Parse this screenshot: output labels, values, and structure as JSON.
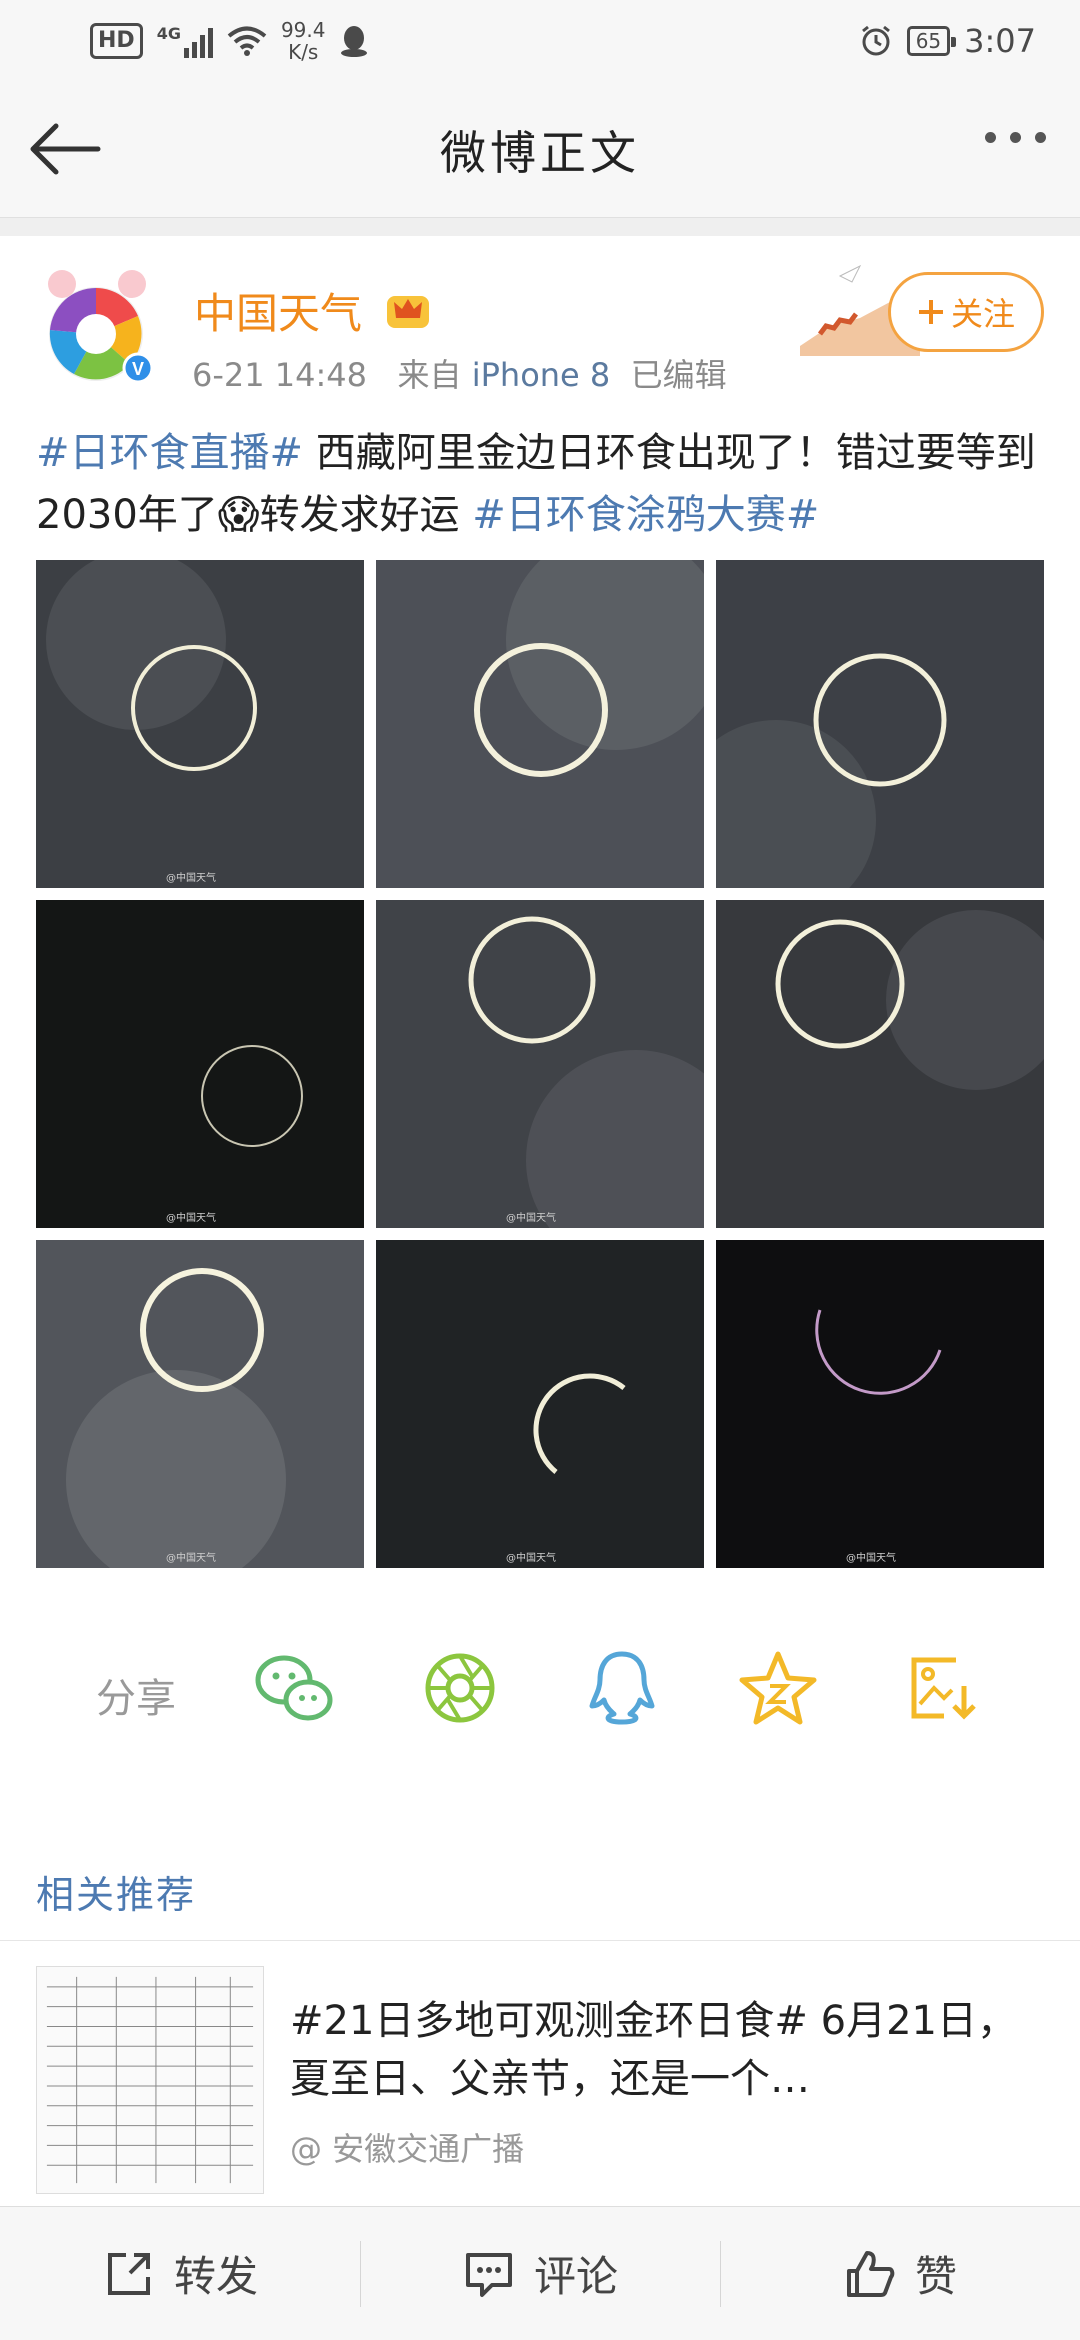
{
  "status_bar": {
    "hd": "HD",
    "network": "4G",
    "speed_value": "99.4",
    "speed_unit": "K/s",
    "battery": "65",
    "time": "3:07"
  },
  "nav": {
    "title": "微博正文"
  },
  "post": {
    "author": "中国天气",
    "time": "6-21 14:48",
    "source_prefix": "来自",
    "source": "iPhone 8",
    "edited": "已编辑",
    "follow_label": "关注",
    "text_parts": {
      "tag1": "#日环食直播#",
      "body1": " 西藏阿里金边日环食出现了！错过要等到2030年了",
      "body2": "转发求好运 ",
      "tag2": "#日环食涂鸦大赛#"
    },
    "image_watermark": "@中国天气"
  },
  "share": {
    "label": "分享"
  },
  "related": {
    "title": "相关推荐",
    "text": "#21日多地可观测金环日食# 6月21日，夏至日、父亲节，还是一个…",
    "source": "@ 安徽交通广播"
  },
  "bottom_bar": {
    "repost": "转发",
    "comment": "评论",
    "like": "赞"
  },
  "colors": {
    "accent_orange": "#f08a1b",
    "link_blue": "#4d7ab1",
    "wechat_green": "#62b96f",
    "qq_blue": "#55a6d8",
    "star_yellow": "#f3b928"
  },
  "icons": [
    "back-arrow-icon",
    "more-icon",
    "vip-crown-icon",
    "plus-icon",
    "wechat-icon",
    "moments-icon",
    "qq-icon",
    "favorite-star-icon",
    "save-image-icon",
    "repost-icon",
    "comment-icon",
    "like-icon"
  ]
}
